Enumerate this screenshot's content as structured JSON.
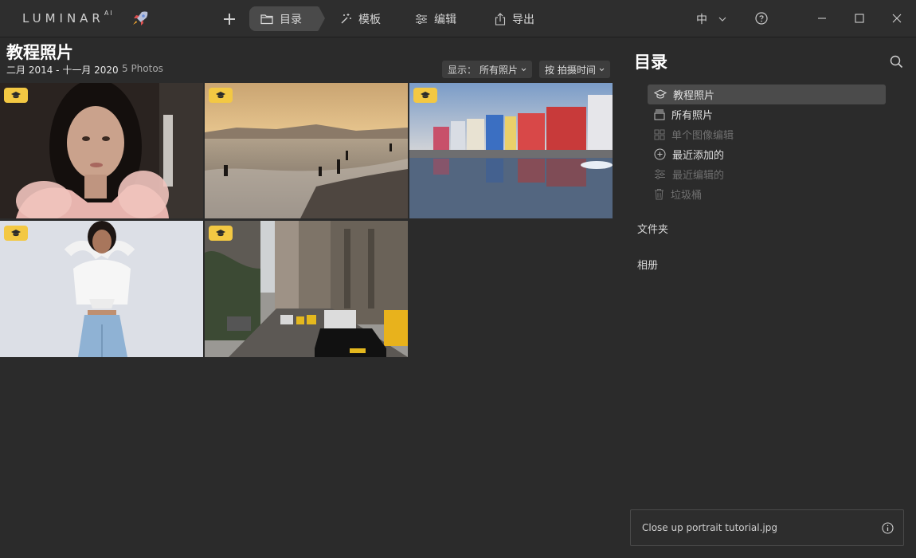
{
  "app": {
    "logo_text": "LUMINAR",
    "logo_suffix": "AI"
  },
  "topbar": {
    "tabs": [
      {
        "label": "目录",
        "icon": "folder-icon",
        "active": true
      },
      {
        "label": "模板",
        "icon": "magic-wand-icon",
        "active": false
      },
      {
        "label": "编辑",
        "icon": "sliders-icon",
        "active": false
      },
      {
        "label": "导出",
        "icon": "share-icon",
        "active": false
      }
    ],
    "language": "中"
  },
  "main": {
    "title": "教程照片",
    "date_range": "二月 2014 - 十一月 2020",
    "photo_count": "5 Photos",
    "filter": {
      "label": "显示：",
      "value": "所有照片"
    },
    "sort": {
      "label": "按 拍摄时间"
    },
    "photos": [
      {
        "subject": "close-up portrait",
        "selected": true
      },
      {
        "subject": "beach sunset"
      },
      {
        "subject": "colorful harbor houses"
      },
      {
        "subject": "woman in white"
      },
      {
        "subject": "city street with taxis"
      }
    ]
  },
  "sidebar": {
    "title": "目录",
    "items": [
      {
        "label": "教程照片",
        "icon": "graduation-cap-icon",
        "active": true,
        "disabled": false
      },
      {
        "label": "所有照片",
        "icon": "stack-icon",
        "active": false,
        "disabled": false
      },
      {
        "label": "单个图像编辑",
        "icon": "grid-icon",
        "active": false,
        "disabled": true
      },
      {
        "label": "最近添加的",
        "icon": "plus-circle-icon",
        "active": false,
        "disabled": false
      },
      {
        "label": "最近编辑的",
        "icon": "sliders-icon",
        "active": false,
        "disabled": true
      },
      {
        "label": "垃圾桶",
        "icon": "trash-icon",
        "active": false,
        "disabled": true
      }
    ],
    "folders_label": "文件夹",
    "albums_label": "相册"
  },
  "info": {
    "filename": "Close up portrait tutorial.jpg"
  },
  "colors": {
    "accent_selection": "#5ac8f0",
    "badge": "#f3c843",
    "background": "#2b2b2b"
  }
}
